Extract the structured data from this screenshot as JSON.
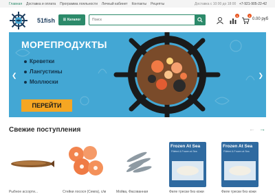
{
  "topbar": {
    "nav": [
      "Главная",
      "Доставка и оплата",
      "Программа лояльности",
      "Личный кабинет",
      "Контакты",
      "Рецепты"
    ],
    "hours": "Доставка с 10:00 до 18:00",
    "phone": "+7-921-905-22-42"
  },
  "header": {
    "logo_text": "51fish",
    "catalog_label": "Каталог",
    "search_placeholder": "Поиск",
    "compare_badge": "0",
    "cart_badge": "0",
    "cart_sum": "0.00 руб"
  },
  "banner": {
    "title": "МОРЕПРОДУКТЫ",
    "items": [
      "Креветки",
      "Лангустины",
      "Моллюски"
    ],
    "cta": "ПЕРЕЙТИ"
  },
  "section": {
    "title": "Свежие поступления"
  },
  "products": [
    {
      "label": "Рыбное ассорти...",
      "kind": "fish"
    },
    {
      "label": "Стейки лосося (Семга), с/м",
      "kind": "salmon"
    },
    {
      "label": "Мойва, Фасованная",
      "kind": "capelin"
    },
    {
      "label": "Филе трески без кожи",
      "kind": "frozen",
      "box_title": "Frozen At Sea",
      "box_sub": "Filleted & Frozen at Sea"
    },
    {
      "label": "Филе трески без кожи",
      "kind": "frozen",
      "box_title": "Frozen At Sea",
      "box_sub": "Filleted & Frozen at Sea"
    }
  ],
  "colors": {
    "brand_green": "#2c8a6a",
    "banner_blue": "#43a7d4",
    "cta_orange": "#f5a623",
    "badge_orange": "#e8541e"
  }
}
